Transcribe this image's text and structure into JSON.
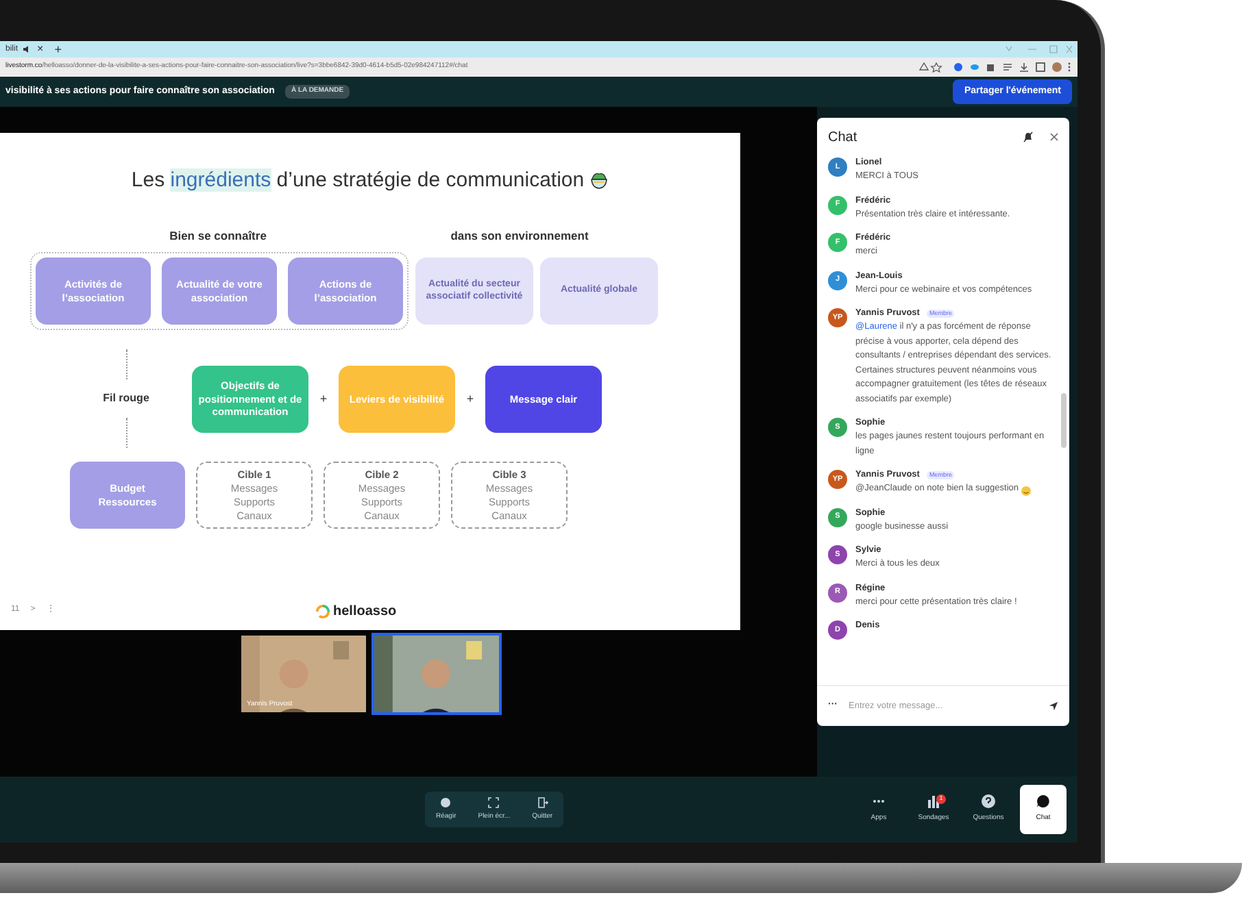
{
  "browser": {
    "tab_title": "bilit",
    "tab_close": "×",
    "new_tab": "+",
    "url_host": "livestorm.co",
    "url_path": "/helloasso/donner-de-la-visibilite-a-ses-actions-pour-faire-connaitre-son-association/live?s=3bbe6842-39d0-4614-b5d5-02e984247112#/chat"
  },
  "header": {
    "title": "visibilité à ses actions pour faire connaître son association",
    "badge": "À LA DEMANDE",
    "share_button": "Partager l'événement"
  },
  "slide": {
    "title_before": "Les ",
    "title_highlight": "ingrédients",
    "title_after": " d’une stratégie de communication",
    "heading_left": "Bien se connaître",
    "heading_right": "dans son environnement",
    "top_boxes": [
      {
        "label": "Activités de l’association",
        "kind": "solid"
      },
      {
        "label": "Actualité de votre association",
        "kind": "solid"
      },
      {
        "label": "Actions de l’association",
        "kind": "solid"
      },
      {
        "label": "Actualité du secteur associatif collectivité",
        "kind": "faded"
      },
      {
        "label": "Actualité globale",
        "kind": "faded"
      }
    ],
    "thread_label": "Fil rouge",
    "middle_boxes": [
      {
        "label": "Objectifs de positionnement et de communication",
        "color": "#34c38a"
      },
      {
        "label": "Leviers de visibilité",
        "color": "#fbbf3c"
      },
      {
        "label": "Message clair",
        "color": "#4f46e5"
      }
    ],
    "plus": "+",
    "budget": "Budget Ressources",
    "targets": [
      {
        "title": "Cible 1",
        "lines": [
          "Messages",
          "Supports",
          "Canaux"
        ]
      },
      {
        "title": "Cible 2",
        "lines": [
          "Messages",
          "Supports",
          "Canaux"
        ]
      },
      {
        "title": "Cible 3",
        "lines": [
          "Messages",
          "Supports",
          "Canaux"
        ]
      }
    ],
    "page_number": "11",
    "next": ">",
    "more": "⋮",
    "logo": "helloasso"
  },
  "videos": [
    {
      "name": "Yannis Pruvost",
      "selected": false
    },
    {
      "selected": true
    }
  ],
  "controls": [
    "Réagir",
    "Plein écr...",
    "Quitter"
  ],
  "chat": {
    "title": "Chat",
    "placeholder": "Entrez votre message...",
    "more": "···",
    "messages": [
      {
        "name": "Lionel",
        "initials": "L",
        "color": "#2f7fc1",
        "text": "MERCI à TOUS"
      },
      {
        "name": "Frédéric",
        "initials": "F",
        "color": "#34c06a",
        "text": "Présentation très claire et intéressante."
      },
      {
        "name": "Frédéric",
        "initials": "F",
        "color": "#34c06a",
        "text": "merci"
      },
      {
        "name": "Jean-Louis",
        "initials": "J",
        "color": "#2f8fd6",
        "text": "Merci pour ce webinaire et vos compétences"
      },
      {
        "name": "Yannis Pruvost",
        "initials": "YP",
        "color": "#c8581c",
        "badge": "Membre",
        "mention": "@Laurene",
        "text": " il n'y a pas forcément de réponse précise à vous apporter, cela dépend des consultants / entreprises dépendant des services. Certaines structures peuvent néanmoins vous accompagner gratuitement (les têtes de réseaux associatifs par exemple)"
      },
      {
        "name": "Sophie",
        "initials": "S",
        "color": "#34a85a",
        "text": "les pages jaunes restent toujours performant en ligne"
      },
      {
        "name": "Yannis Pruvost",
        "initials": "YP",
        "color": "#c8581c",
        "badge": "Membre",
        "text": "@JeanClaude on note bien la suggestion",
        "emoji": true
      },
      {
        "name": "Sophie",
        "initials": "S",
        "color": "#34a85a",
        "text": "google businesse aussi"
      },
      {
        "name": "Sylvie",
        "initials": "S",
        "color": "#8e44ad",
        "text": "Merci à tous les deux"
      },
      {
        "name": "Régine",
        "initials": "R",
        "color": "#9b59b6",
        "text": "merci pour cette présentation très claire !"
      },
      {
        "name": "Denis",
        "initials": "D",
        "color": "#8e44ad"
      }
    ]
  },
  "side_tabs": [
    {
      "label": "Apps",
      "kind": "dots",
      "selected": false
    },
    {
      "label": "Sondages",
      "kind": "bars",
      "badge": "1",
      "selected": false
    },
    {
      "label": "Questions",
      "kind": "question",
      "selected": false
    },
    {
      "label": "Chat",
      "kind": "chat",
      "selected": true
    }
  ]
}
